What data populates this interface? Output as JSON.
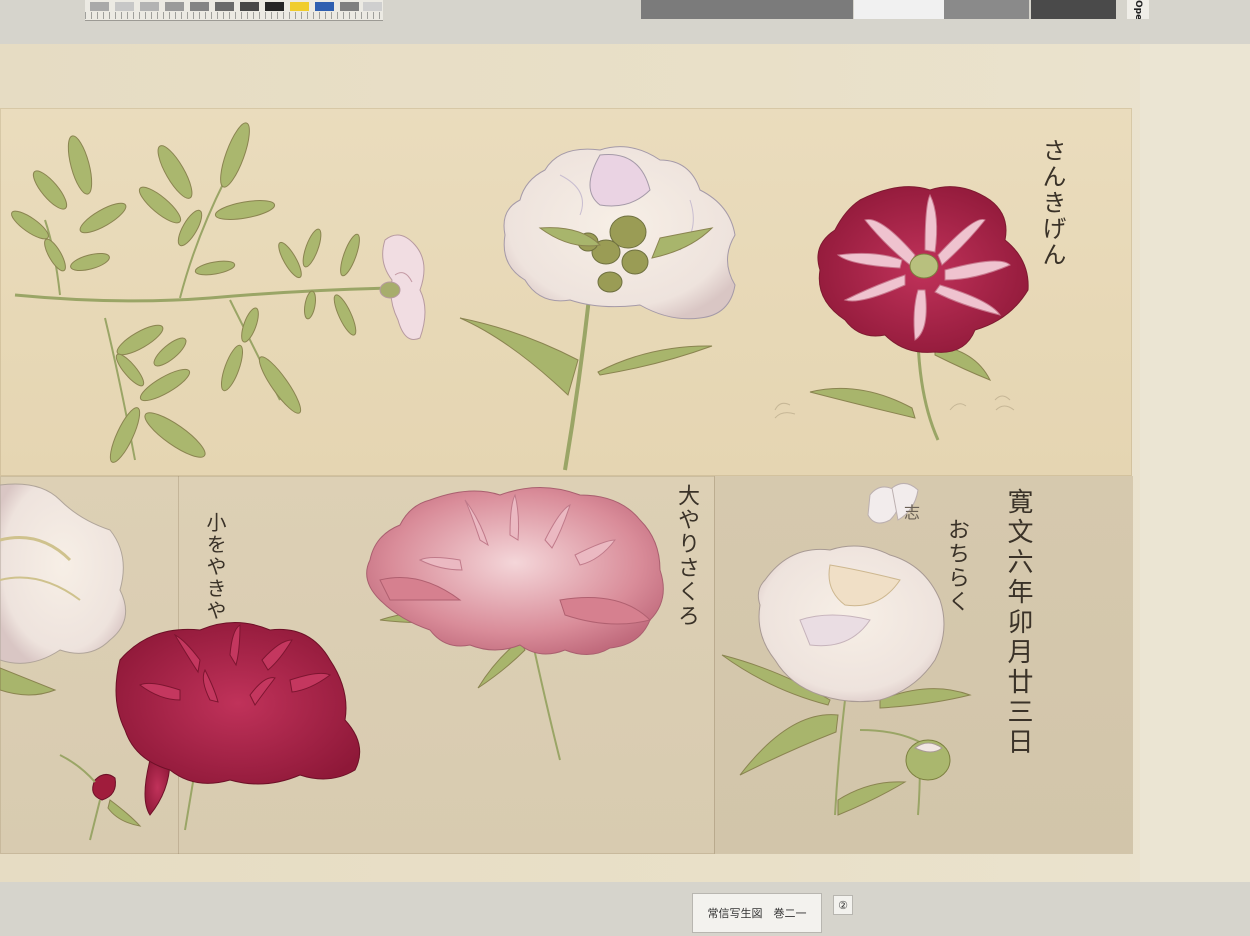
{
  "inscriptions": {
    "top_right": "さんきげん",
    "bottom_center": "大やりさくろ",
    "bottom_left": "小をやきや",
    "date": "寛文六年卯月廿三日",
    "bottom_right": "おちらく",
    "small_note": "志"
  },
  "label": {
    "title": "常信写生図　巻二一",
    "number": "②"
  },
  "color_card": {
    "label": "Ope",
    "swatches": [
      "#9b9b9b",
      "#b5b5b5",
      "#c8c8c8",
      "#7d7d7d",
      "#5a5a5a",
      "#3a3a3a",
      "#202020",
      "#f1cf2e",
      "#2f5fb0",
      "#8f8f8f",
      "#c9c9c9"
    ]
  },
  "colors": {
    "paper": "#e7d8b6",
    "crimson": "#9e1d3c",
    "pink": "#d78fa0",
    "leaf": "#a6b46a"
  }
}
